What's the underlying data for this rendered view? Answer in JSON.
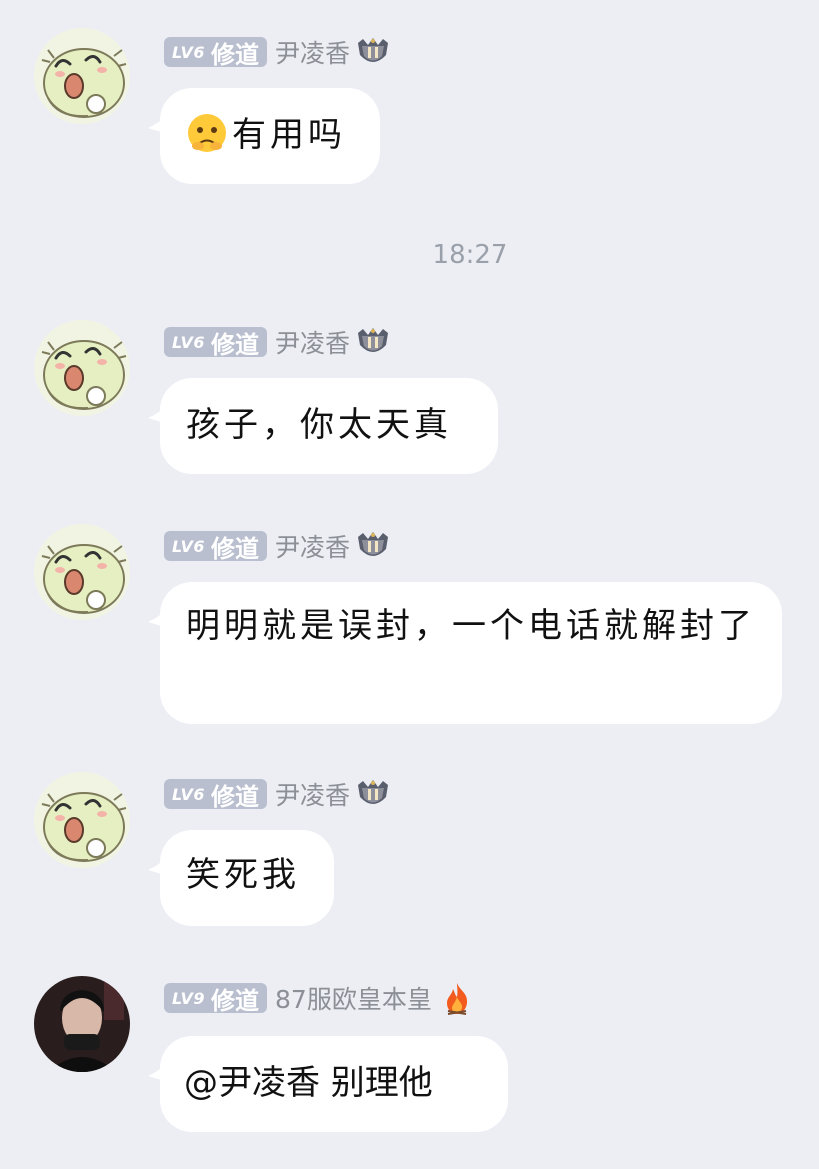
{
  "messages": [
    {
      "level": "LV6",
      "title": "修道",
      "nick": "尹凌香",
      "text": "有用吗",
      "has_emoji": true
    },
    {
      "level": "LV6",
      "title": "修道",
      "nick": "尹凌香",
      "text": "孩子，你太天真"
    },
    {
      "level": "LV6",
      "title": "修道",
      "nick": "尹凌香",
      "text": "明明就是误封，一个电话就解封了"
    },
    {
      "level": "LV6",
      "title": "修道",
      "nick": "尹凌香",
      "text": "笑死我"
    },
    {
      "level": "LV9",
      "title": "修道",
      "nick": "87服欧皇本皇",
      "text": "@尹凌香 别理他"
    }
  ],
  "timestamp": "18:27",
  "icons": {
    "emoji": "worried-face-icon",
    "crest": "rank-crest-icon",
    "fire": "fire-icon",
    "avatar_cartoon": "cartoon-avatar",
    "avatar_photo": "photo-avatar"
  },
  "colors": {
    "background": "#eceef4",
    "bubble": "#ffffff",
    "badge": "#b9bfcf",
    "nick": "#8c8f96"
  }
}
